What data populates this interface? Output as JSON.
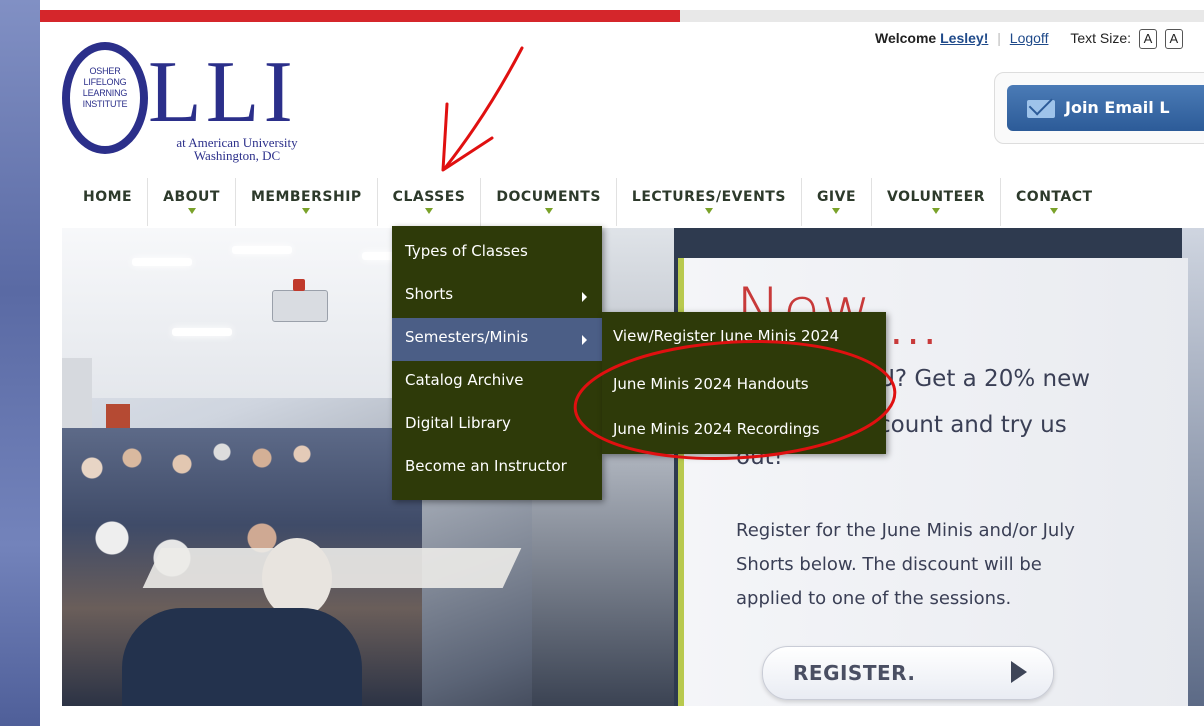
{
  "header": {
    "welcome_prefix": "Welcome",
    "user_name": "Lesley!",
    "logoff": "Logoff",
    "text_size_label": "Text Size:",
    "text_size_btn_1": "A",
    "text_size_btn_2": "A",
    "join_email": "Join Email L"
  },
  "logo": {
    "o_text_1": "OSHER",
    "o_text_2": "LIFELONG",
    "o_text_3": "LEARNING",
    "o_text_4": "INSTITUTE",
    "lli": "LLI",
    "sub_1": "at American University",
    "sub_2": "Washington, DC"
  },
  "nav": {
    "items": [
      {
        "label": "HOME"
      },
      {
        "label": "ABOUT"
      },
      {
        "label": "MEMBERSHIP"
      },
      {
        "label": "CLASSES"
      },
      {
        "label": "DOCUMENTS"
      },
      {
        "label": "LECTURES/EVENTS"
      },
      {
        "label": "GIVE"
      },
      {
        "label": "VOLUNTEER"
      },
      {
        "label": "CONTACT"
      }
    ]
  },
  "classes_menu": {
    "items": [
      {
        "label": "Types of Classes"
      },
      {
        "label": "Shorts"
      },
      {
        "label": "Semesters/Minis"
      },
      {
        "label": "Catalog Archive"
      },
      {
        "label": "Digital Library"
      },
      {
        "label": "Become an Instructor"
      }
    ]
  },
  "semesters_submenu": {
    "items": [
      {
        "label": "View/Register June Minis 2024"
      },
      {
        "label": "June Minis 2024 Handouts"
      },
      {
        "label": "June Minis 2024 Recordings"
      }
    ]
  },
  "promo": {
    "title": "New",
    "dots": "...",
    "line_a": "U? Get a 20% new",
    "line_b": "count and try us",
    "line_c": "out!",
    "body_1": "Register for the June Minis and/or July",
    "body_2": "Shorts below. The discount will be",
    "body_3": "applied to one of the sessions.",
    "register": "REGISTER."
  },
  "colors": {
    "accent_red": "#d5262b",
    "logo_blue": "#2b2f8a",
    "menu_bg": "#2e3a09",
    "menu_active": "#4b5e86",
    "annotation_red": "#e01010"
  }
}
